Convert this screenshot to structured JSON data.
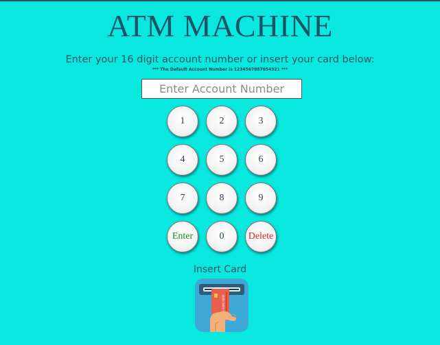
{
  "title": "ATM MACHINE",
  "instruction": "Enter your 16 digit account number or insert your card below:",
  "default_note": "*** The Default Account Number is 1234567887654321 ***",
  "account_input": {
    "value": "",
    "placeholder": "Enter Account Number"
  },
  "keypad": {
    "keys": [
      "1",
      "2",
      "3",
      "4",
      "5",
      "6",
      "7",
      "8",
      "9",
      "Enter",
      "0",
      "Delete"
    ]
  },
  "insert_card_label": "Insert Card",
  "card_icon": {
    "name": "insert-card-icon",
    "card_text": "0000 0000 0000"
  },
  "colors": {
    "background": "#08e8de",
    "title": "#1d5368",
    "enter_text": "#1a8a1a",
    "delete_text": "#e02020",
    "icon_background": "#3ea8d8",
    "card": "#e8604c"
  }
}
